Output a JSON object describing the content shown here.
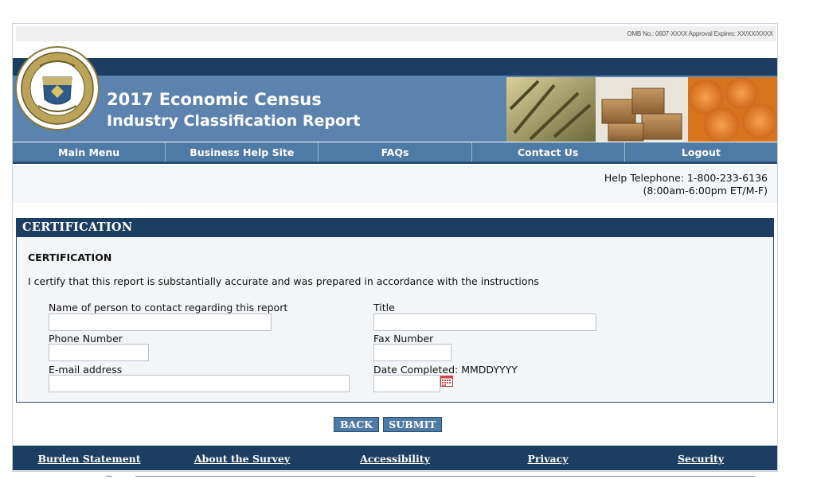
{
  "omb": {
    "text": "OMB No.: 0607-XXXX  Approval Expires: XX/XX/XXXX"
  },
  "header": {
    "title_line1": "2017 Economic Census",
    "title_line2": "Industry Classification Report",
    "seal_text_top": "U.S. DEPARTMENT OF COMMERCE",
    "seal_text_bottom": "BUREAU OF THE CENSUS"
  },
  "nav": {
    "items": [
      {
        "label": "Main Menu"
      },
      {
        "label": "Business Help Site"
      },
      {
        "label": "FAQs"
      },
      {
        "label": "Contact Us"
      },
      {
        "label": "Logout"
      }
    ]
  },
  "help": {
    "telephone": "Help Telephone: 1-800-233-6136",
    "hours": "(8:00am-6:00pm ET/M-F)"
  },
  "certification": {
    "header": "CERTIFICATION",
    "subheader": "CERTIFICATION",
    "statement": "I certify that this report is substantially accurate and was prepared in accordance with the instructions",
    "fields": {
      "contact_name": {
        "label": "Name of person to contact regarding this report",
        "value": ""
      },
      "title": {
        "label": "Title",
        "value": ""
      },
      "phone": {
        "label": "Phone Number",
        "value": ""
      },
      "fax": {
        "label": "Fax Number",
        "value": ""
      },
      "email": {
        "label": "E-mail address",
        "value": ""
      },
      "date_completed": {
        "label": "Date Completed: MMDDYYYY",
        "value": ""
      }
    }
  },
  "buttons": {
    "back": "BACK",
    "submit": "SUBMIT"
  },
  "footer": {
    "links": [
      {
        "label": "Burden Statement"
      },
      {
        "label": "About the Survey"
      },
      {
        "label": "Accessibility"
      },
      {
        "label": "Privacy"
      },
      {
        "label": "Security"
      }
    ]
  },
  "colors": {
    "banner_dark": "#1d3e63",
    "banner_mid": "#5b83ad",
    "nav_bg": "#4e7aa6",
    "section_bg": "#f3f5f7"
  }
}
